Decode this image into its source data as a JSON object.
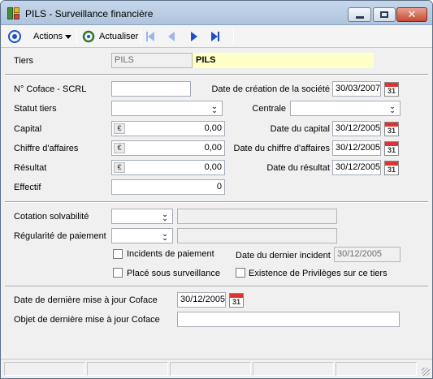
{
  "window": {
    "title": "PILS -  Surveillance financière"
  },
  "toolbar": {
    "actions_label": "Actions",
    "refresh_label": "Actualiser"
  },
  "tiers": {
    "label": "Tiers",
    "code": "PILS",
    "name": "PILS"
  },
  "company": {
    "coface_label": "N° Coface - SCRL",
    "coface_value": "",
    "creation_label": "Date de création de la société",
    "creation_value": "30/03/2007",
    "statut_label": "Statut tiers",
    "statut_value": "",
    "centrale_label": "Centrale",
    "centrale_value": "",
    "capital_label": "Capital",
    "capital_value": "0,00",
    "date_capital_label": "Date du capital",
    "date_capital_value": "30/12/2005",
    "ca_label": "Chiffre d'affaires",
    "ca_value": "0,00",
    "date_ca_label": "Date du chiffre d'affaires",
    "date_ca_value": "30/12/2005",
    "resultat_label": "Résultat",
    "resultat_value": "0,00",
    "date_resultat_label": "Date du résultat",
    "date_resultat_value": "30/12/2005",
    "effectif_label": "Effectif",
    "effectif_value": "0"
  },
  "risk": {
    "cotation_label": "Cotation solvabilité",
    "cotation_value": "",
    "cotation_desc": "",
    "regularite_label": "Régularité de paiement",
    "regularite_value": "",
    "regularite_desc": "",
    "incidents_label": "Incidents de paiement",
    "dernier_incident_label": "Date du dernier incident",
    "dernier_incident_value": "30/12/2005",
    "surveillance_label": "Placé sous surveillance",
    "privileges_label": "Existence de Privilèges sur ce tiers"
  },
  "coface_update": {
    "date_label": "Date de dernière mise à jour Coface",
    "date_value": "30/12/2005",
    "objet_label": "Objet de dernière mise à jour Coface",
    "objet_value": ""
  },
  "icons": {
    "calendar_number": "31",
    "euro": "€"
  }
}
